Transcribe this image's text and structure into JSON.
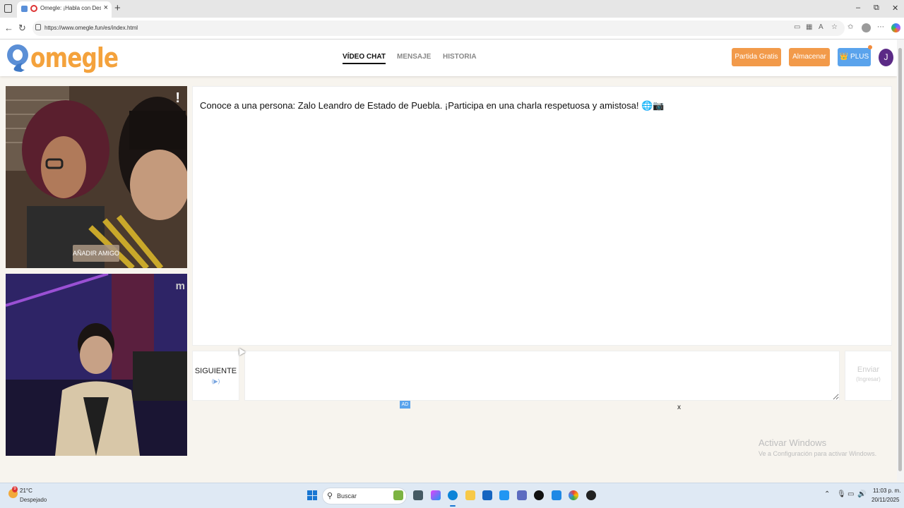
{
  "browser": {
    "tab_title": "Omegle: ¡Habla con Desconocidos!",
    "tab_close": "×",
    "new_tab": "+",
    "url": "https://www.omegle.fun/es/index.html",
    "window_controls": {
      "minimize": "–",
      "maximize": "⧉",
      "close": "✕"
    }
  },
  "site": {
    "logo_text": "omegle",
    "nav": [
      {
        "label": "VÍDEO CHAT",
        "active": true
      },
      {
        "label": "MENSAJE",
        "active": false
      },
      {
        "label": "HISTORIA",
        "active": false
      }
    ],
    "buttons": {
      "free_game": "Partida Gratis",
      "store": "Almacenar",
      "plus": "👑 PLUS"
    },
    "avatar_letter": "J",
    "accent_orange": "#f29a4a",
    "accent_blue": "#5aa3ec",
    "logo_orange": "#f4a23c"
  },
  "videos": {
    "report_mark": "!",
    "add_friend": "AÑADIR AMIGO",
    "watermark": "m"
  },
  "chat": {
    "message": "Conoce a una persona: Zalo Leandro de Estado de Puebla. ¡Participa en una charla respetuosa y amistosa! 🌐📷",
    "next_label": "SIGUIENTE",
    "next_hint": "(▶)",
    "input_placeholder": "",
    "send_label": "Enviar",
    "send_hint": "(Ingresar)",
    "ad_badge": "AD",
    "ad_close": "x"
  },
  "windows_watermark": {
    "title": "Activar Windows",
    "subtitle": "Ve a Configuración para activar Windows."
  },
  "taskbar": {
    "weather_badge": "9",
    "weather_temp": "21°C",
    "weather_desc": "Despejado",
    "search_label": "Buscar",
    "clock_time": "11:03 p. m.",
    "clock_date": "20/11/2025"
  }
}
